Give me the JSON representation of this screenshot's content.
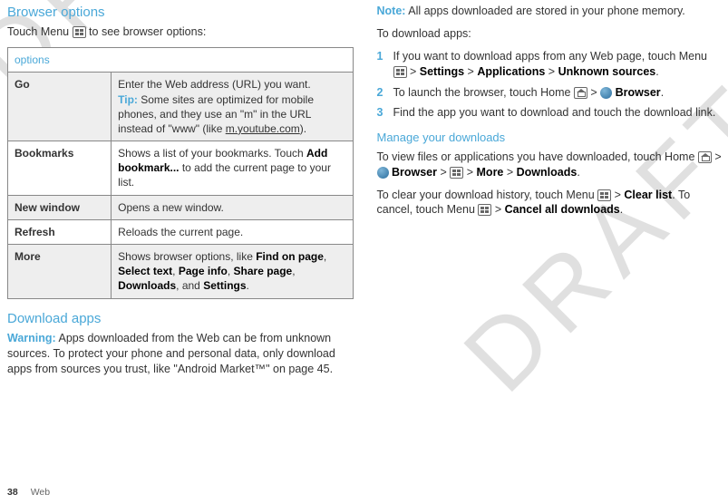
{
  "left": {
    "heading": "Browser options",
    "intro_pre": "Touch Menu ",
    "intro_post": " to see browser options:",
    "table_header": "options",
    "rows": [
      {
        "label": "Go",
        "desc_main": "Enter the Web address (URL) you want.",
        "tip_label": "Tip:",
        "tip_text": " Some sites are optimized for mobile phones, and they use an \"m\" in the URL instead of \"www\" (like ",
        "tip_link": "m.youtube.com",
        "tip_close": ")."
      },
      {
        "label": "Bookmarks",
        "desc_pre": "Shows a list of your bookmarks. Touch ",
        "desc_bold": "Add bookmark...",
        "desc_post": " to add the current page to your list."
      },
      {
        "label": "New window",
        "desc_main": "Opens a new window."
      },
      {
        "label": "Refresh",
        "desc_main": "Reloads the current page."
      },
      {
        "label": "More",
        "desc_pre": "Shows browser options, like ",
        "b1": "Find on page",
        "s1": ", ",
        "b2": "Select text",
        "s2": ", ",
        "b3": "Page info",
        "s3": ", ",
        "b4": "Share page",
        "s4": ", ",
        "b5": "Downloads",
        "s5": ", and ",
        "b6": "Settings",
        "s6": "."
      }
    ],
    "download_heading": "Download apps",
    "warning_label": "Warning:",
    "warning_text": " Apps downloaded from the Web can be from unknown sources. To protect your phone and personal data, only download apps from sources you trust, like \"Android Market™\" on page 45."
  },
  "right": {
    "note_label": "Note:",
    "note_text": " All apps downloaded are stored in your phone memory.",
    "to_download": "To download apps:",
    "steps": [
      {
        "pre": "If you want to download apps from any Web page, touch Menu ",
        "gt1": " > ",
        "b1": "Settings",
        "gt2": " > ",
        "b2": "Applications",
        "gt3": " > ",
        "b3": "Unknown sources",
        "post": "."
      },
      {
        "pre": "To launch the browser, touch Home ",
        "gt1": " > ",
        "b1": "Browser",
        "post": "."
      },
      {
        "pre": "Find the app you want to download and touch the download link."
      }
    ],
    "manage_heading": "Manage your downloads",
    "view_pre": "To view files or applications you have downloaded, touch Home ",
    "view_gt1": " > ",
    "view_b1": "Browser",
    "view_gt2": " > ",
    "view_gt3": " > ",
    "view_b2": "More",
    "view_gt4": " > ",
    "view_b3": "Downloads",
    "view_post": ".",
    "clear_pre": "To clear your download history, touch Menu ",
    "clear_gt1": " > ",
    "clear_b1": "Clear list",
    "clear_mid": ". To cancel, touch Menu ",
    "clear_gt2": " > ",
    "clear_b2": "Cancel all downloads",
    "clear_post": "."
  },
  "footer": {
    "page": "38",
    "section": "Web"
  }
}
